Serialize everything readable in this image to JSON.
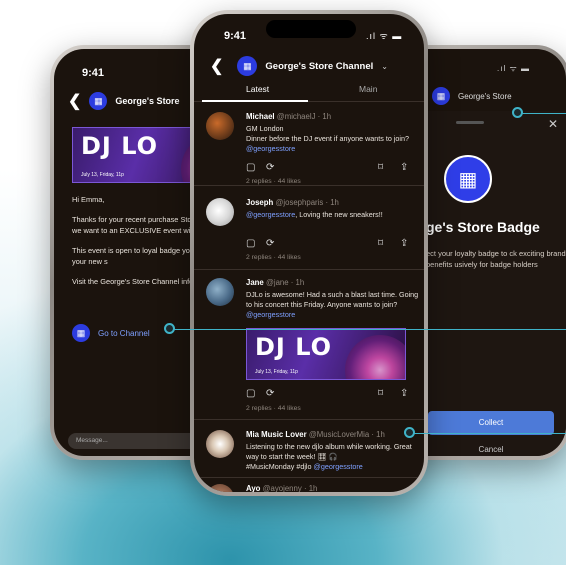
{
  "colors": {
    "accent": "#2c3ce0",
    "link": "#7ea0ff",
    "background": "#1b130d",
    "callout": "#3fb3c8",
    "collect_button": "#4d7ad8"
  },
  "left_phone": {
    "time": "9:41",
    "back_icon": "chevron-left-icon",
    "title": "George's Store",
    "banner": {
      "title": "DJ LO",
      "date": "July 13, Friday, 11p"
    },
    "message": {
      "greeting": "Hi Emma,",
      "para1": "Thanks for your recent purchase Store.  As a thank you we want to an EXCLUSIVE event with DJ Lo, London.",
      "para2": "This event is open to loyal badge you only! Come wear your new s",
      "para3": "Visit the George's Store Channel information!"
    },
    "go_channel_label": "Go to Channel",
    "composer_placeholder": "Message..."
  },
  "center_phone": {
    "time": "9:41",
    "title": "George's Store Channel",
    "tabs": [
      "Latest",
      "Main"
    ],
    "posts": [
      {
        "name": "Michael",
        "handle": "@michaelJ",
        "time": "· 1h",
        "text": "GM London\nDinner before the DJ event if anyone wants to join?",
        "mention": "@georgesstore",
        "stats": "2 replies  ·  44 likes"
      },
      {
        "name": "Joseph",
        "handle": "@josephparis",
        "time": "· 1h",
        "mention": "@georgesstore",
        "text": ", Loving the new sneakers!!",
        "stats": "2 replies  ·  44 likes"
      },
      {
        "name": "Jane",
        "handle": "@jane",
        "time": "· 1h",
        "text": "DJLo is awesome! Had a such a blast last time. Going to his concert this Friday. Anyone wants to join?",
        "mention": "@georgesstore",
        "banner": {
          "title": "DJ LO",
          "date": "July 13, Friday, 11p"
        },
        "stats": "2 replies  ·  44 likes"
      },
      {
        "name": "Mia Music Lover",
        "handle": "@MusicLoverMia",
        "time": "· 1h",
        "text": "Listening to the new djlo album while working. Great way to start the week! 🎛 🎧\n#MusicMonday #djlo",
        "mention": "@georgesstore"
      },
      {
        "name": "Ayo",
        "handle": "@ayojenny",
        "time": "· 1h"
      }
    ],
    "action_icons": [
      "comment-icon",
      "repost-icon",
      "bookmark-icon",
      "share-icon"
    ]
  },
  "right_phone": {
    "title": "George's Store",
    "badge_title": "ge's Store Badge",
    "description": "ect your loyalty badge to ck exciting brand benefits usively for badge holders",
    "collect_label": "Collect",
    "cancel_label": "Cancel"
  }
}
